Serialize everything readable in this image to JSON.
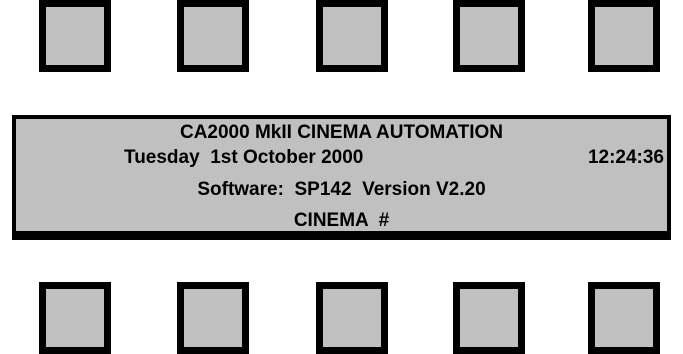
{
  "soft_keys": {
    "top": [
      {
        "name": "top-key-1"
      },
      {
        "name": "top-key-2"
      },
      {
        "name": "top-key-3"
      },
      {
        "name": "top-key-4"
      },
      {
        "name": "top-key-5"
      }
    ],
    "bottom": [
      {
        "name": "bottom-key-1"
      },
      {
        "name": "bottom-key-2"
      },
      {
        "name": "bottom-key-3"
      },
      {
        "name": "bottom-key-4"
      },
      {
        "name": "bottom-key-5"
      }
    ]
  },
  "display": {
    "title": "CA2000 MkII CINEMA AUTOMATION",
    "date": "Tuesday  1st October 2000",
    "time": "12:24:36",
    "software": "Software:  SP142  Version V2.20",
    "cinema": "CINEMA  #"
  },
  "colors": {
    "key_fill": "#c0c0c0",
    "display_fill": "#c0c0c0",
    "border": "#000000"
  }
}
